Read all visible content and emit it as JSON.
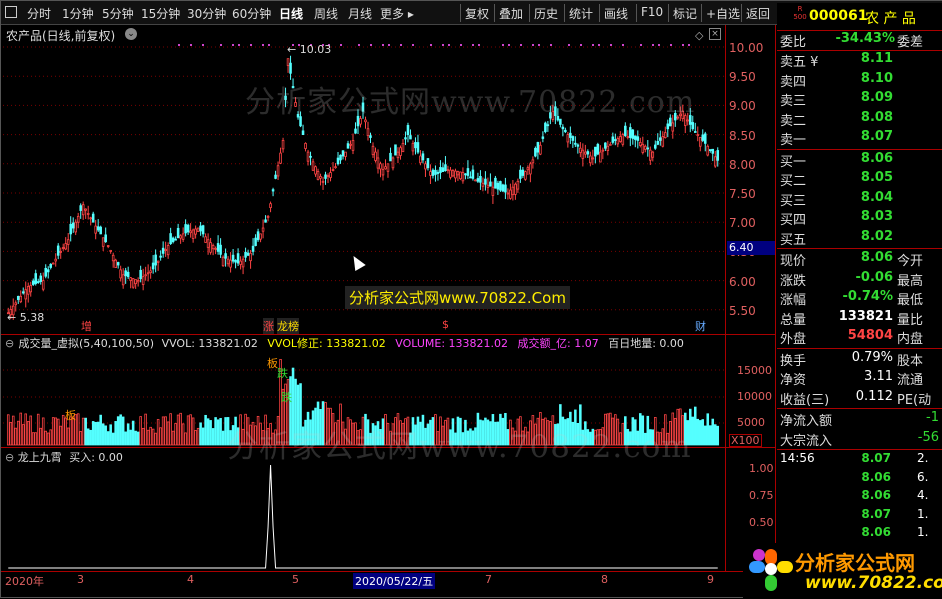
{
  "toolbar": {
    "left_items": [
      "分时",
      "1分钟",
      "5分钟",
      "15分钟",
      "30分钟",
      "60分钟",
      "日线",
      "周线",
      "月线",
      "更多 ▸"
    ],
    "right_items": [
      "复权",
      "叠加",
      "历史",
      "统计",
      "画线",
      "F10",
      "标记",
      "+自选",
      "返回"
    ],
    "selected": "日线"
  },
  "stock": {
    "code": "000061",
    "name": "农 产 品",
    "badge_top": "R",
    "badge_bottom": "500",
    "chart_title": "农产品(日线,前复权)"
  },
  "price_axis": [
    "10.00",
    "9.50",
    "9.00",
    "8.50",
    "8.00",
    "7.50",
    "7.00",
    "6.50",
    "6.00",
    "5.50"
  ],
  "current_price_tag": "6.40",
  "markers": {
    "high": "10.03",
    "low": "5.38",
    "events": [
      "增",
      "涨",
      "龙榜",
      "$",
      "财"
    ]
  },
  "volume": {
    "header": "成交量_虚拟(5,40,100,50)",
    "vvol": "VVOL: 133821.02",
    "vvol_fix": "VVOL修正: 133821.02",
    "volume": "VOLUME: 133821.02",
    "amount": "成交额_亿: 1.07",
    "hundred": "百日地量: 0.00",
    "axis": [
      "15000",
      "10000",
      "5000"
    ],
    "unit": "X100",
    "tags": [
      "板",
      "板",
      "跌",
      "跌"
    ]
  },
  "indicator": {
    "name": "龙上九霄",
    "buy": "买入: 0.00",
    "axis": [
      "1.00",
      "0.75",
      "0.50",
      "0.25",
      "0.00"
    ]
  },
  "date_axis": {
    "labels": [
      "2020年",
      "3",
      "4",
      "5",
      "2020/05/22/五",
      "7",
      "8",
      "9"
    ]
  },
  "quote": {
    "weibi_label": "委比",
    "weibi_val": "-34.43%",
    "weicha_label": "委差",
    "sell": [
      {
        "label": "卖五 ¥",
        "price": "8.11"
      },
      {
        "label": "卖四",
        "price": "8.10"
      },
      {
        "label": "卖三",
        "price": "8.09"
      },
      {
        "label": "卖二",
        "price": "8.08"
      },
      {
        "label": "卖一",
        "price": "8.07"
      }
    ],
    "buy": [
      {
        "label": "买一",
        "price": "8.06"
      },
      {
        "label": "买二",
        "price": "8.05"
      },
      {
        "label": "买三",
        "price": "8.04"
      },
      {
        "label": "买四",
        "price": "8.03"
      },
      {
        "label": "买五",
        "price": "8.02"
      }
    ],
    "stats": [
      {
        "label": "现价",
        "value": "8.06",
        "label2": "今开",
        "color": "green"
      },
      {
        "label": "涨跌",
        "value": "-0.06",
        "label2": "最高",
        "color": "green"
      },
      {
        "label": "涨幅",
        "value": "-0.74%",
        "label2": "最低",
        "color": "green"
      },
      {
        "label": "总量",
        "value": "133821",
        "label2": "量比",
        "color": "white"
      },
      {
        "label": "外盘",
        "value": "54804",
        "label2": "内盘",
        "color": "red"
      }
    ],
    "stats2": [
      {
        "label": "换手",
        "value": "0.79%",
        "label2": "股本"
      },
      {
        "label": "净资",
        "value": "3.11",
        "label2": "流通"
      },
      {
        "label": "收益(三)",
        "value": "0.112",
        "label2": "PE(动"
      }
    ],
    "flow": [
      {
        "label": "净流入额",
        "value": "-1"
      },
      {
        "label": "大宗流入",
        "value": "-56"
      }
    ],
    "ticks_time": "14:56",
    "ticks": [
      {
        "price": "8.07",
        "vol": "2."
      },
      {
        "price": "8.06",
        "vol": "6."
      },
      {
        "price": "8.06",
        "vol": "4."
      },
      {
        "price": "8.07",
        "vol": "1."
      },
      {
        "price": "8.06",
        "vol": "1."
      }
    ]
  },
  "watermark": {
    "top": "分析家公式网www.70822.com",
    "center": "分析家公式网www.70822.Com",
    "volume": "分析家公式网www.70822.com",
    "logo_text": "分析家公式网",
    "logo_url": "www.70822.com"
  },
  "colors": {
    "up": "#ff4444",
    "down": "#55ffff",
    "grid": "#7a0000",
    "green": "#33dd33",
    "accent_yellow": "#ffff00",
    "magenta": "#ff44ff"
  }
}
